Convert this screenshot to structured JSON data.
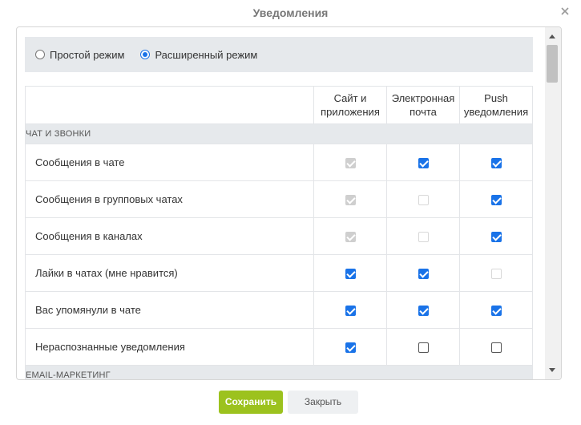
{
  "dialog": {
    "title": "Уведомления"
  },
  "mode": {
    "options": [
      {
        "label": "Простой режим",
        "selected": false
      },
      {
        "label": "Расширенный режим",
        "selected": true
      }
    ]
  },
  "table": {
    "columns": [
      "Сайт и приложения",
      "Электронная почта",
      "Push уведомления"
    ],
    "sections": [
      {
        "title": "ЧАТ И ЗВОНКИ",
        "rows": [
          {
            "label": "Сообщения в чате",
            "states": [
              "disabled-checked",
              "checked",
              "checked"
            ]
          },
          {
            "label": "Сообщения в групповых чатах",
            "states": [
              "disabled-checked",
              "disabled-unchecked",
              "checked"
            ]
          },
          {
            "label": "Сообщения в каналах",
            "states": [
              "disabled-checked",
              "disabled-unchecked",
              "checked"
            ]
          },
          {
            "label": "Лайки в чатах (мне нравится)",
            "states": [
              "checked",
              "checked",
              "disabled-unchecked"
            ]
          },
          {
            "label": "Вас упомянули в чате",
            "states": [
              "checked",
              "checked",
              "checked"
            ]
          },
          {
            "label": "Нераспознанные уведомления",
            "states": [
              "checked",
              "unchecked",
              "unchecked"
            ]
          }
        ]
      },
      {
        "title": "EMAIL-МАРКЕТИНГ",
        "rows": []
      }
    ]
  },
  "footer": {
    "save_label": "Сохранить",
    "close_label": "Закрыть"
  },
  "colors": {
    "accent": "#1a73e8",
    "save": "#9cc21e",
    "section_bg": "#e6e9ec"
  }
}
